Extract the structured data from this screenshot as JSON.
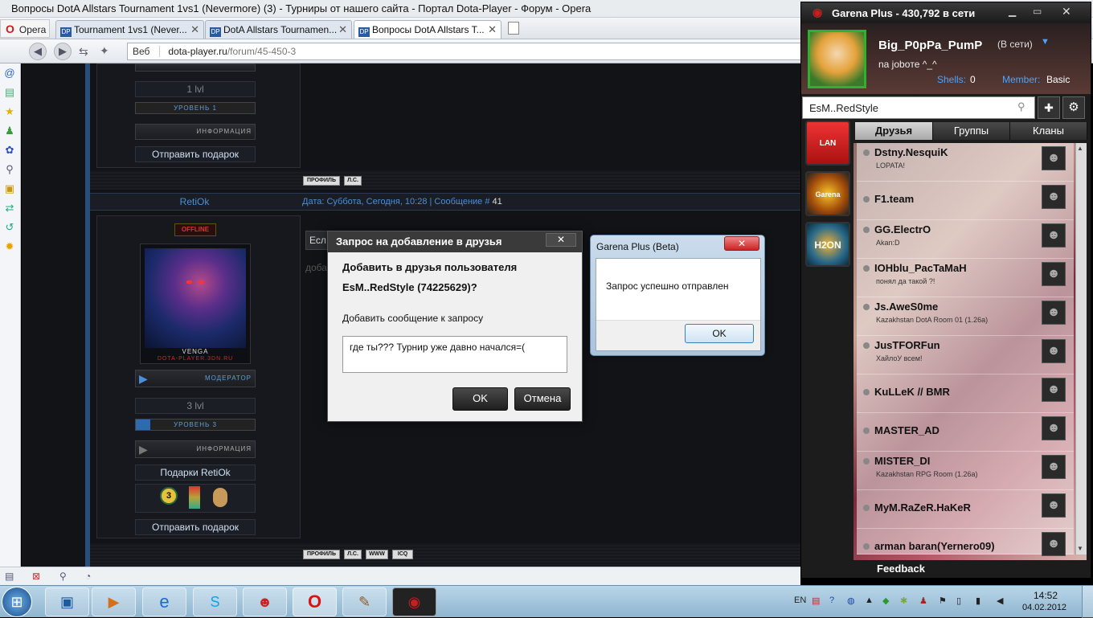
{
  "window_title": "Вопросы DotA Allstars Tournament 1vs1 (Nevermore) (3) - Турниры от нашего сайта - Портал Dota-Player - Форум - Opera",
  "opera_menu": "Opera",
  "tabs": [
    {
      "label": "Tournament 1vs1 (Never..."
    },
    {
      "label": "DotA Allstars Tournamen..."
    },
    {
      "label": "Вопросы DotA Allstars T..."
    }
  ],
  "tab_favicon": "DP",
  "address": {
    "web_label": "Веб",
    "host": "dota-player.ru",
    "path": "/forum/45-450-3"
  },
  "forum": {
    "prev_user": {
      "level": "1 lvl",
      "level_bar": "УРОВЕНЬ 1",
      "info_bar": "ИНФОРМАЦИЯ",
      "send_gift": "Отправить подарок"
    },
    "post_buttons": [
      "ПРОФИЛЬ",
      "Л.С."
    ],
    "post": {
      "username": "RetiOk",
      "meta_prefix": "Дата: Суббота, Сегодня, 10:28 | Сообщение #",
      "meta_number": "41",
      "status_badge": "OFFLINE",
      "avatar_caption": "VENGA",
      "avatar_site": "DOTA-PLAYER.3DN.RU",
      "rank_bar": "МОДЕРАТОР",
      "level": "3 lvl",
      "level_bar": "УРОВЕНЬ 3",
      "info_bar": "ИНФОРМАЦИЯ",
      "gifts_title": "Подарки RetiOk",
      "send_gift": "Отправить подарок",
      "text_fragment_1": "Есл",
      "text_fragment_2": "доба"
    },
    "footer_buttons": [
      "ПРОФИЛЬ",
      "Л.С.",
      "WWW",
      "ICQ"
    ]
  },
  "add_friend_dialog": {
    "title": "Запрос на добавление в друзья",
    "close": "✕",
    "line1": "Добавить в друзья пользователя",
    "line2": "EsM..RedStyle (74225629)?",
    "message_label": "Добавить сообщение к запросу",
    "message_value": "где ты??? Турнир уже давно начался=(",
    "ok": "OK",
    "cancel": "Отмена"
  },
  "confirm_dialog": {
    "title": "Garena Plus (Beta)",
    "close": "✕",
    "message": "Запрос успешно отправлен",
    "ok": "OK"
  },
  "garena": {
    "title": "Garena Plus - 430,792 в сети",
    "username": "Big_P0pPa_PumP",
    "status": "(В сети)",
    "mood": "na joboте ^_^",
    "shells_label": "Shells:",
    "shells_value": "0",
    "member_label": "Member:",
    "member_value": "Basic",
    "search_value": "EsM..RedStyle",
    "tabs": [
      "Друзья",
      "Группы",
      "Кланы"
    ],
    "app_icons": [
      "LAN",
      "Garena Blast",
      "H2ON"
    ],
    "friends": [
      {
        "name": "Dstny.NesquiK",
        "status": "LOPATA!"
      },
      {
        "name": "F1.team",
        "status": ""
      },
      {
        "name": "GG.ElectrO",
        "status": "Akan:D"
      },
      {
        "name": "IOHblu_PacTaMaH",
        "status": "понял да такой ?!"
      },
      {
        "name": "Js.AweS0me",
        "status": "Kazakhstan DotA Room 01 (1.26a)"
      },
      {
        "name": "JusTFORFun",
        "status": "ХайлоУ всем!"
      },
      {
        "name": "KuLLeK // BMR",
        "status": ""
      },
      {
        "name": "MASTER_AD",
        "status": ""
      },
      {
        "name": "MISTER_DI",
        "status": "Kazakhstan RPG Room (1.26a)"
      },
      {
        "name": "MyM.RaZeR.HaKeR",
        "status": ""
      },
      {
        "name": "arman baran(Yernero09)",
        "status": ""
      }
    ],
    "feedback": "Feedback"
  },
  "taskbar": {
    "lang": "EN",
    "time": "14:52",
    "date": "04.02.2012"
  },
  "colors": {
    "garena_red": "#c81e1e",
    "forum_blue": "#4a8fd8",
    "taskbar": "#9fc3dc"
  }
}
